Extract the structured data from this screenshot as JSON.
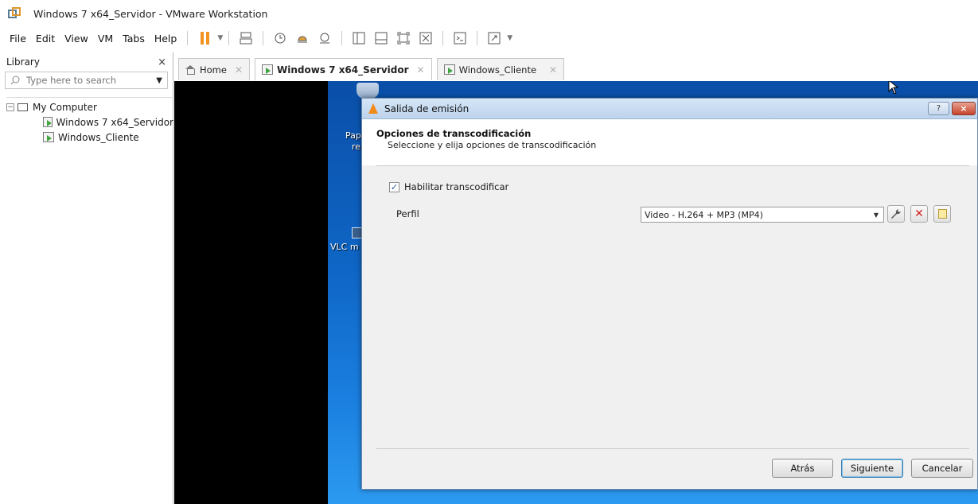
{
  "window": {
    "title": "Windows 7 x64_Servidor - VMware Workstation"
  },
  "menu": {
    "items": [
      "File",
      "Edit",
      "View",
      "VM",
      "Tabs",
      "Help"
    ]
  },
  "library": {
    "title": "Library",
    "close": "×",
    "search_placeholder": "Type here to search",
    "tree": {
      "root": "My Computer",
      "children": [
        "Windows 7 x64_Servidor",
        "Windows_Cliente"
      ]
    }
  },
  "tabs": [
    {
      "label": "Home",
      "active": false
    },
    {
      "label": "Windows 7 x64_Servidor",
      "active": true
    },
    {
      "label": "Windows_Cliente",
      "active": false
    }
  ],
  "desktop": {
    "icon1_label_line1": "Pap",
    "icon1_label_line2": "re",
    "icon2_label": "VLC m"
  },
  "dialog": {
    "title": "Salida de emisión",
    "help": "?",
    "close": "×",
    "heading": "Opciones de transcodificación",
    "subheading": "Seleccione y elija opciones de transcodificación",
    "checkbox_label": "Habilitar transcodificar",
    "checkbox_checked": true,
    "profile_label": "Perfil",
    "profile_value": "Video - H.264 + MP3 (MP4)",
    "buttons": {
      "back": "Atrás",
      "next": "Siguiente",
      "cancel": "Cancelar"
    }
  },
  "colors": {
    "accent_orange": "#f39322",
    "dialog_border": "#6d8cb1",
    "desktop_blue": "#0f66c6"
  }
}
